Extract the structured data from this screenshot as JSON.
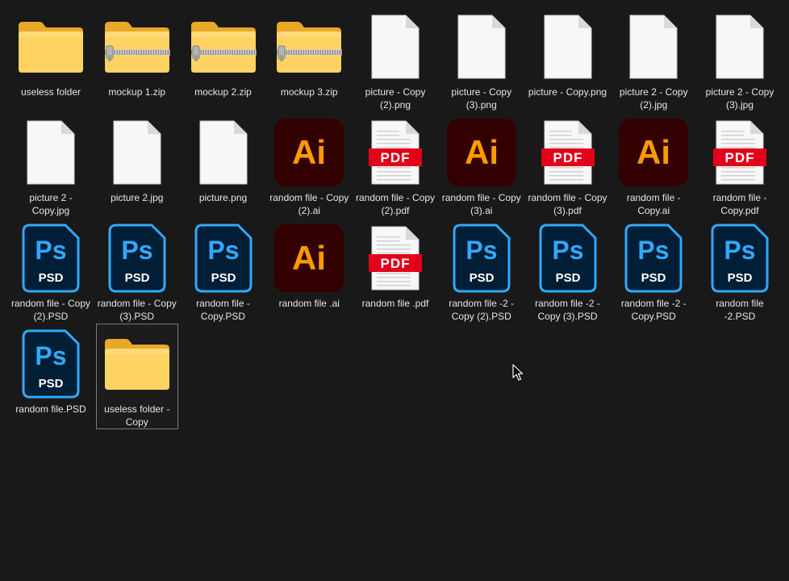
{
  "files": [
    {
      "name": "useless folder",
      "icon": "folder-icon",
      "selected": false
    },
    {
      "name": "mockup 1.zip",
      "icon": "zip-folder-icon",
      "selected": false
    },
    {
      "name": "mockup 2.zip",
      "icon": "zip-folder-icon",
      "selected": false
    },
    {
      "name": "mockup 3.zip",
      "icon": "zip-folder-icon",
      "selected": false
    },
    {
      "name": "picture - Copy (2).png",
      "icon": "blank-file-icon",
      "selected": false
    },
    {
      "name": "picture - Copy (3).png",
      "icon": "blank-file-icon",
      "selected": false
    },
    {
      "name": "picture - Copy.png",
      "icon": "blank-file-icon",
      "selected": false
    },
    {
      "name": "picture 2 - Copy (2).jpg",
      "icon": "blank-file-icon",
      "selected": false
    },
    {
      "name": "picture 2 - Copy (3).jpg",
      "icon": "blank-file-icon",
      "selected": false
    },
    {
      "name": "picture 2 - Copy.jpg",
      "icon": "blank-file-icon",
      "selected": false
    },
    {
      "name": "picture 2.jpg",
      "icon": "blank-file-icon",
      "selected": false
    },
    {
      "name": "picture.png",
      "icon": "blank-file-icon",
      "selected": false
    },
    {
      "name": "random file - Copy (2).ai",
      "icon": "illustrator-icon",
      "selected": false
    },
    {
      "name": "random file - Copy (2).pdf",
      "icon": "pdf-icon",
      "selected": false
    },
    {
      "name": "random file - Copy (3).ai",
      "icon": "illustrator-icon",
      "selected": false
    },
    {
      "name": "random file - Copy (3).pdf",
      "icon": "pdf-icon",
      "selected": false
    },
    {
      "name": "random file - Copy.ai",
      "icon": "illustrator-icon",
      "selected": false
    },
    {
      "name": "random file - Copy.pdf",
      "icon": "pdf-icon",
      "selected": false
    },
    {
      "name": "random file - Copy (2).PSD",
      "icon": "photoshop-icon",
      "selected": false
    },
    {
      "name": "random file - Copy (3).PSD",
      "icon": "photoshop-icon",
      "selected": false
    },
    {
      "name": "random file - Copy.PSD",
      "icon": "photoshop-icon",
      "selected": false
    },
    {
      "name": "random file .ai",
      "icon": "illustrator-icon",
      "selected": false
    },
    {
      "name": "random file .pdf",
      "icon": "pdf-icon",
      "selected": false
    },
    {
      "name": "random file -2 - Copy (2).PSD",
      "icon": "photoshop-icon",
      "selected": false
    },
    {
      "name": "random file -2 - Copy (3).PSD",
      "icon": "photoshop-icon",
      "selected": false
    },
    {
      "name": "random file -2 - Copy.PSD",
      "icon": "photoshop-icon",
      "selected": false
    },
    {
      "name": "random file -2.PSD",
      "icon": "photoshop-icon",
      "selected": false
    },
    {
      "name": "random file.PSD",
      "icon": "photoshop-icon",
      "selected": false
    },
    {
      "name": "useless folder - Copy",
      "icon": "folder-icon",
      "selected": true
    }
  ],
  "icon_text": {
    "ai": "Ai",
    "ps": "Ps",
    "psd": "PSD",
    "pdf": "PDF"
  },
  "colors": {
    "background": "#191919",
    "folder_back": "#e8a928",
    "folder_front": "#ffd361",
    "ai_bg": "#330000",
    "ai_text": "#ff9a00",
    "ps_bg": "#001e36",
    "ps_text": "#31a8ff",
    "pdf_red": "#e2001a"
  }
}
